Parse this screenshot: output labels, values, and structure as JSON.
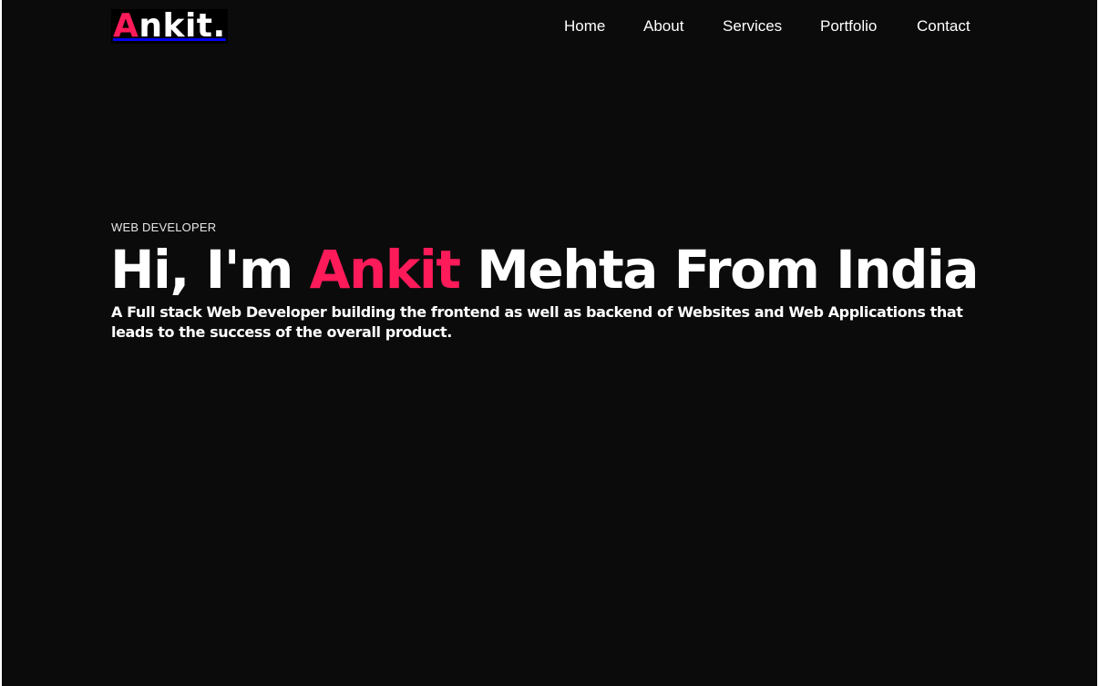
{
  "brand": {
    "logo_accent": "A",
    "logo_rest": "nkit.",
    "accent_color": "#ff1a5a",
    "background_color": "#0b0b0c"
  },
  "nav": {
    "items": [
      {
        "label": "Home"
      },
      {
        "label": "About"
      },
      {
        "label": "Services"
      },
      {
        "label": "Portfolio"
      },
      {
        "label": "Contact"
      }
    ]
  },
  "hero": {
    "eyebrow": "WEB DEVELOPER",
    "headline_prefix": "Hi, I'm ",
    "headline_name": "Ankit",
    "headline_suffix": " Mehta From India",
    "tagline": "A Full stack Web Developer building the frontend as well as backend of Websites and Web Applications that leads to the success of the overall product."
  }
}
